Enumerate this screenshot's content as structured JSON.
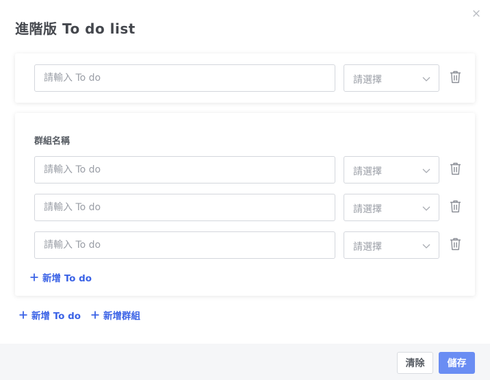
{
  "dialog": {
    "title": "進階版 To do list",
    "close_glyph": "×"
  },
  "todo_placeholder": "請輸入 To do",
  "select_placeholder": "請選擇",
  "ungrouped": {
    "items": [
      {
        "value": "",
        "category": ""
      }
    ]
  },
  "groups": [
    {
      "name": "群組名稱",
      "items": [
        {
          "value": "",
          "category": ""
        },
        {
          "value": "",
          "category": ""
        },
        {
          "value": "",
          "category": ""
        }
      ],
      "add_todo_label": "新增 To do"
    }
  ],
  "actions": {
    "add_todo_label": "新增 To do",
    "add_group_label": "新增群組"
  },
  "footer": {
    "clear_label": "清除",
    "save_label": "儲存"
  },
  "colors": {
    "accent": "#3b63e6",
    "primary_button": "#6a8df3",
    "placeholder": "#9a9ea6"
  },
  "icons": {
    "close": "close-icon",
    "dropdown": "chevron-down-icon",
    "delete": "trash-icon",
    "add": "plus-icon"
  }
}
